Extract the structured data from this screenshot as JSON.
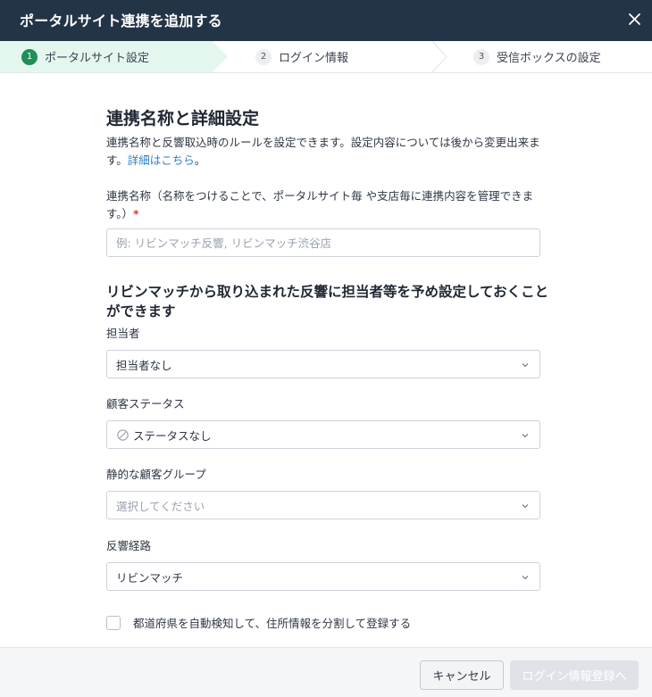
{
  "dialog": {
    "title": "ポータルサイト連携を追加する"
  },
  "steps": [
    {
      "number": "1",
      "label": "ポータルサイト設定"
    },
    {
      "number": "2",
      "label": "ログイン情報"
    },
    {
      "number": "3",
      "label": "受信ボックスの設定"
    }
  ],
  "section1": {
    "heading": "連携名称と詳細設定",
    "description": "連携名称と反響取込時のルールを設定できます。設定内容については後から変更出来ます。",
    "link_text": "詳細はこちら",
    "after_link": "。"
  },
  "name_field": {
    "label": "連携名称（名称をつけることで、ポータルサイト毎 や支店毎に連携内容を管理できます。）",
    "required_mark": "*",
    "placeholder": "例: リビンマッチ反響, リビンマッチ渋谷店",
    "value": ""
  },
  "section2": {
    "heading": "リビンマッチから取り込まれた反響に担当者等を予め設定しておくことができます"
  },
  "fields": {
    "assignee": {
      "label": "担当者",
      "value": "担当者なし"
    },
    "customer_status": {
      "label": "顧客ステータス",
      "value": "ステータスなし"
    },
    "static_group": {
      "label": "静的な顧客グループ",
      "placeholder": "選択してください"
    },
    "channel": {
      "label": "反響経路",
      "value": "リビンマッチ"
    }
  },
  "checkbox": {
    "label": "都道府県を自動検知して、住所情報を分割して登録する",
    "checked": false
  },
  "footer": {
    "cancel_label": "キャンセル",
    "next_label": "ログイン情報登録へ"
  },
  "colors": {
    "header_bg": "#243447",
    "active_step_bg": "#e4f7ef",
    "active_step_num": "#1f8f57",
    "link": "#2f7fc1",
    "required": "#d93a3a",
    "disabled_button": "#dfe3e8"
  },
  "icons": {
    "close": "close-icon",
    "chevron": "chevron-down-icon",
    "no_status": "no-status-icon"
  }
}
